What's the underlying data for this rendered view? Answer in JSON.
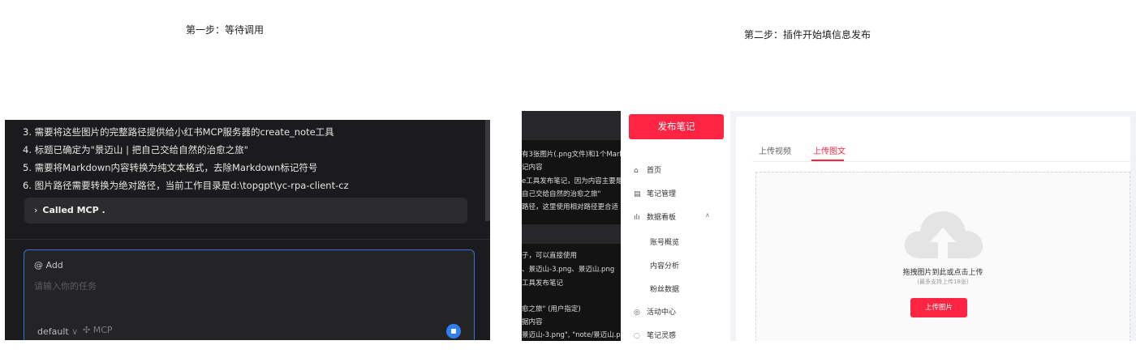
{
  "captions": {
    "step1": "第一步：等待调用",
    "step2": "第二步：插件开始填信息发布"
  },
  "chat": {
    "steps": [
      "3. 需要将这些图片的完整路径提供给小红书MCP服务器的create_note工具",
      "4. 标题已确定为\"景迈山 | 把自己交给自然的治愈之旅\"",
      "5. 需要将Markdown内容转换为纯文本格式，去除Markdown标记符号",
      "6. 图片路径需要转换为绝对路径，当前工作目录是d:\\topgpt\\yc-rpa-client-cz"
    ],
    "called_mcp": "Called MCP .",
    "input": {
      "add_label": "@ Add",
      "placeholder": "请输入你的任务",
      "model": "default",
      "mcp_label": "MCP"
    }
  },
  "terminal_snippets": [
    "有3张图片(.png文件)和1个Markdo",
    "记内容",
    "e工具发布笔记，因为内容主要是",
    "自己交给自然的治愈之旅\"",
    "路径，这里使用相对路径更合适",
    "子，可以直接使用",
    "、景迈山-3.png、景迈山.png",
    "工具发布笔记",
    "愈之旅\" (用户指定)",
    "据内容",
    "景迈山-3.png\", \"note/景迈山.pn"
  ],
  "xhs": {
    "publish_button": "发布笔记",
    "nav": {
      "home": "首页",
      "note_manage": "笔记管理",
      "data_board": "数据看板",
      "account_overview": "账号概览",
      "content_analysis": "内容分析",
      "fans_data": "粉丝数据",
      "activity_center": "活动中心",
      "note_inspiration": "笔记灵感"
    },
    "tabs": {
      "video": "上传视频",
      "image": "上传图文"
    },
    "upload": {
      "hint": "拖拽图片到此或点击上传",
      "limit": "(最多支持上传18张)",
      "button": "上传图片"
    },
    "accent_color": "#ff2442"
  }
}
